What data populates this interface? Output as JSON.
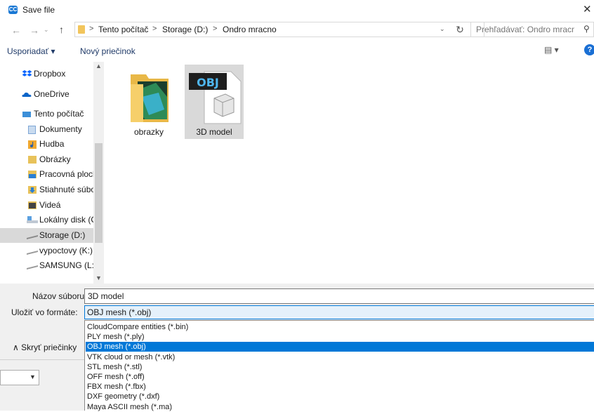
{
  "window": {
    "title": "Save file",
    "app_icon": "CC",
    "close_glyph": "✕"
  },
  "nav_buttons": {
    "back": "←",
    "forward": "→",
    "recent": "⌄",
    "up": "↑"
  },
  "address": {
    "crumbs": [
      "Tento počítač",
      "Storage (D:)",
      "Ondro mracno"
    ],
    "separator": ">",
    "dropdown_glyph": "⌄",
    "refresh_glyph": "↻"
  },
  "search": {
    "placeholder": "Prehľadávať: Ondro mracno",
    "icon": "search-icon"
  },
  "toolbar": {
    "organize": "Usporiadať ▾",
    "new_folder": "Nový priečinok",
    "view": "▤ ▾",
    "help": "?"
  },
  "nav_pane": {
    "items": [
      {
        "label": "Dropbox",
        "icon": "dropbox-icon",
        "color": "#0061fe"
      },
      {
        "label": "OneDrive",
        "icon": "onedrive-icon",
        "color": "#0a64c8"
      },
      {
        "label": "Tento počítač",
        "icon": "computer-icon",
        "color": "#3c8fd8"
      },
      {
        "label": "Dokumenty",
        "icon": "documents-icon",
        "color": "#7fa7d6"
      },
      {
        "label": "Hudba",
        "icon": "music-icon",
        "color": "#f0a830"
      },
      {
        "label": "Obrázky",
        "icon": "pictures-icon",
        "color": "#e8c25a"
      },
      {
        "label": "Pracovná plocha",
        "icon": "desktop-icon",
        "color": "#2a7fd4"
      },
      {
        "label": "Stiahnuté súbory",
        "icon": "downloads-icon",
        "color": "#2a7fd4"
      },
      {
        "label": "Videá",
        "icon": "videos-icon",
        "color": "#555555"
      },
      {
        "label": "Lokálny disk (C:)",
        "icon": "drive-c-icon",
        "color": "#8fb1d8"
      },
      {
        "label": "Storage (D:)",
        "icon": "drive-icon",
        "color": "#9a9a9a",
        "selected": true
      },
      {
        "label": "vypoctovy (K:)",
        "icon": "drive-icon",
        "color": "#9a9a9a"
      },
      {
        "label": "SAMSUNG (L:)",
        "icon": "drive-icon",
        "color": "#9a9a9a"
      }
    ],
    "scroll_up": "▲",
    "scroll_down": "▼"
  },
  "content": {
    "items": [
      {
        "name": "obrazky",
        "icon": "folder-icon"
      },
      {
        "name": "3D model",
        "icon": "obj-file-icon",
        "badge": "OBJ"
      }
    ]
  },
  "form": {
    "filename_label": "Názov súboru:",
    "filename_value": "3D model",
    "filetype_label": "Uložiť vo formáte:",
    "filetype_value": "OBJ mesh (*.obj)",
    "filetype_options": [
      "CloudCompare entities (*.bin)",
      "PLY mesh (*.ply)",
      "OBJ mesh (*.obj)",
      "VTK cloud or mesh (*.vtk)",
      "STL mesh (*.stl)",
      "OFF mesh (*.off)",
      "FBX mesh (*.fbx)",
      "DXF geometry (*.dxf)",
      "Maya ASCII mesh (*.ma)"
    ],
    "selected_index": 2,
    "hide_folders": "∧  Skryť priečinky",
    "small_select_arrow": "▼"
  },
  "colors": {
    "accent": "#0078d7",
    "selection_gray": "#d9d9d9",
    "form_bg": "#f0f0f0"
  }
}
